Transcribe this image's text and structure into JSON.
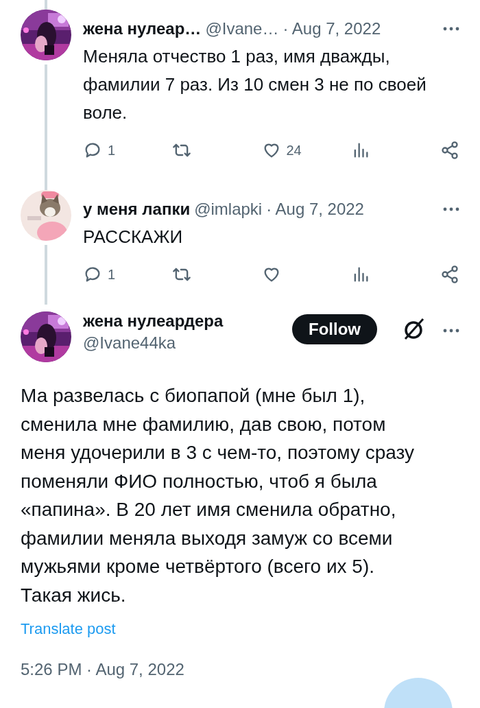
{
  "replies": [
    {
      "name": "жена нулеар…",
      "handle": "@Ivane…",
      "date": "· Aug 7, 2022",
      "text": "Меняла отчество 1 раз, имя дважды, фамилии 7 раз. Из 10 смен 3 не по своей воле.",
      "actions": [
        {
          "kind": "reply",
          "count": "1"
        },
        {
          "kind": "repost"
        },
        {
          "kind": "like",
          "count": "24"
        },
        {
          "kind": "views"
        },
        {
          "kind": "share"
        }
      ]
    },
    {
      "name": "у меня лапки",
      "handle": "@imlapki",
      "date": "· Aug 7, 2022",
      "text": "РАССКАЖИ",
      "actions": [
        {
          "kind": "reply",
          "count": "1"
        },
        {
          "kind": "repost"
        },
        {
          "kind": "like"
        },
        {
          "kind": "views"
        },
        {
          "kind": "share"
        }
      ]
    }
  ],
  "main_post": {
    "name": "жена нулеардера",
    "handle": "@Ivane44ka",
    "follow_button": "Follow",
    "text": "Ма развелась с биопапой (мне был 1), сменила мне фамилию, дав свою, потом меня удочерили в 3 с чем-то, поэтому сразу поменяли ФИО полностью, чтоб я была «папина». В 20 лет имя сменила обратно, фамилии меняла выходя замуж со всеми мужьями кроме четвёртого (всего их 5). Такая жись.",
    "translate_link": "Translate post",
    "timestamp": "5:26 PM · Aug 7, 2022"
  }
}
